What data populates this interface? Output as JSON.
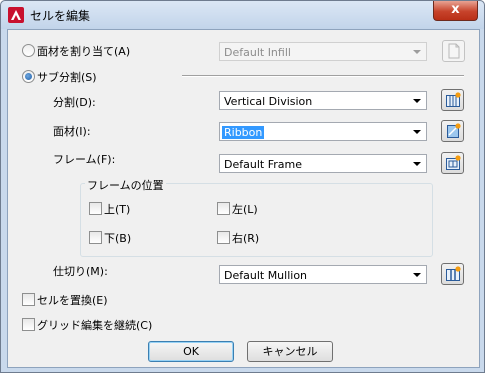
{
  "window": {
    "title": "セルを編集",
    "close_label": "x"
  },
  "assign_material": {
    "label": "面材を割り当て(A)",
    "selected": false,
    "dropdown_value": "Default Infill",
    "enabled": false
  },
  "subdivision": {
    "label": "サブ分割(S)",
    "selected": true,
    "division": {
      "label": "分割(D):",
      "value": "Vertical Division"
    },
    "material": {
      "label": "面材(I):",
      "value": "Ribbon"
    },
    "frame": {
      "label": "フレーム(F):",
      "value": "Default Frame"
    },
    "frame_position": {
      "title": "フレームの位置",
      "top": {
        "label": "上(T)",
        "checked": false
      },
      "left": {
        "label": "左(L)",
        "checked": false
      },
      "bottom": {
        "label": "下(B)",
        "checked": false
      },
      "right": {
        "label": "右(R)",
        "checked": false
      }
    },
    "mullion": {
      "label": "仕切り(M):",
      "value": "Default Mullion"
    }
  },
  "replace_cell": {
    "label": "セルを置換(E)",
    "checked": false
  },
  "continue_grid_edit": {
    "label": "グリッド編集を継続(C)",
    "checked": false
  },
  "buttons": {
    "ok": "OK",
    "cancel": "キャンセル"
  },
  "colors": {
    "titlebar": "#c9d9ec",
    "close": "#c7432b",
    "selection": "#3399ff"
  },
  "icons": [
    "autocad-logo-icon",
    "division-style-icon",
    "material-style-icon",
    "frame-style-icon",
    "mullion-style-icon"
  ]
}
